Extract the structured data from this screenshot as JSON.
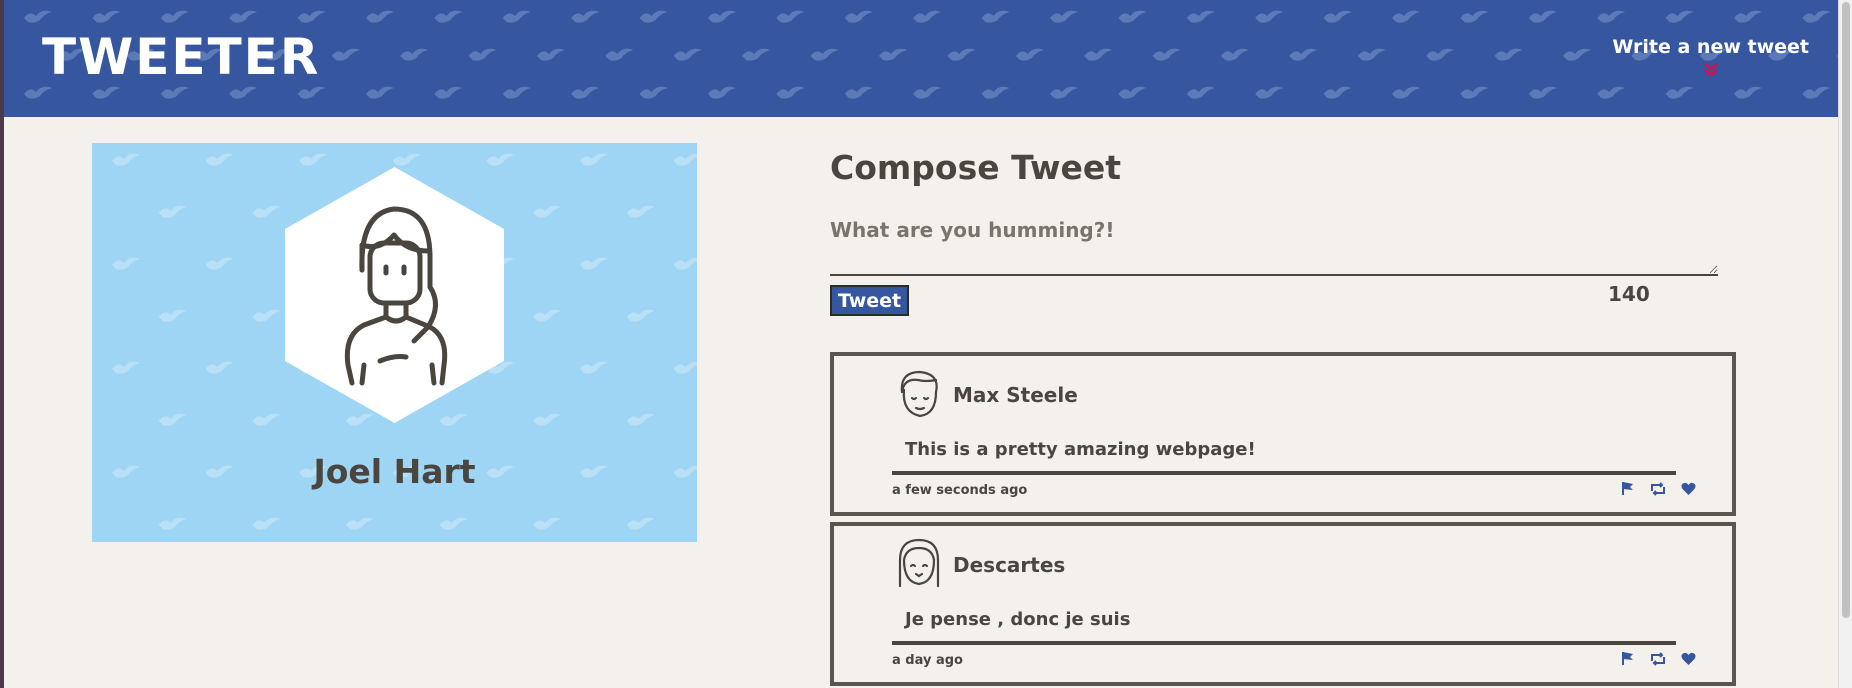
{
  "header": {
    "logo": "TWEETER",
    "compose_link": "Write a new tweet"
  },
  "profile": {
    "name": "Joel Hart"
  },
  "compose": {
    "title": "Compose Tweet",
    "placeholder": "What are you humming?!",
    "button_label": "Tweet",
    "counter": "140"
  },
  "tweets": [
    {
      "name": "Max Steele",
      "body": "This is a pretty amazing webpage!",
      "time": "a few seconds ago"
    },
    {
      "name": "Descartes",
      "body": "Je pense , donc je suis",
      "time": "a day ago"
    }
  ],
  "icons": {
    "header_chevron": "double-chevron-down-icon",
    "flag": "flag-icon",
    "retweet": "retweet-icon",
    "like": "heart-icon"
  },
  "colors": {
    "header_bg": "#36579f",
    "page_bg": "#f4f1ec",
    "profile_bg": "#9fd5f4",
    "text": "#4a453e",
    "accent_chevron": "#c2185b",
    "action_icons": "#36579f"
  }
}
